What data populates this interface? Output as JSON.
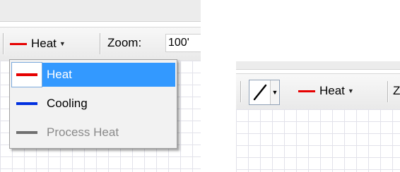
{
  "left": {
    "line_type_combo": {
      "label": "Heat",
      "swatch_color": "#e60000"
    },
    "zoom": {
      "label": "Zoom:",
      "value": "100'"
    },
    "menu": {
      "items": [
        {
          "label": "Heat",
          "color": "#e60000",
          "state": "selected"
        },
        {
          "label": "Cooling",
          "color": "#0030e0",
          "state": "enabled"
        },
        {
          "label": "Process Heat",
          "color": "#707070",
          "state": "disabled"
        }
      ]
    }
  },
  "right": {
    "tool": {
      "icon": "line-tool-icon"
    },
    "line_type_combo": {
      "label": "Heat",
      "swatch_color": "#e60000"
    },
    "next_label": "Z"
  },
  "colors": {
    "selection": "#3399ff",
    "disabled_text": "#8a8a8a"
  }
}
